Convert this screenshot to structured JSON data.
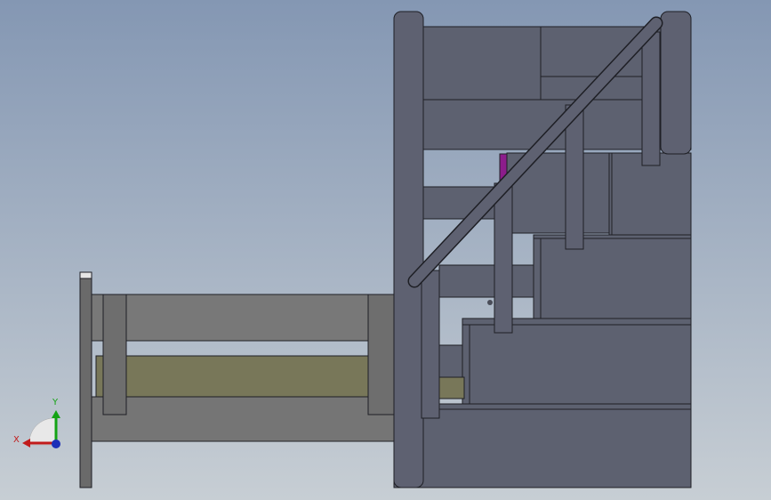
{
  "viewport": {
    "background_top": "#8497b3",
    "background_bottom": "#c7ced4"
  },
  "colors": {
    "stair_body": "#5d6170",
    "stair_edge": "#1e1f25",
    "rail": "#5e6171",
    "frame_grey": "#777777",
    "frame_dark": "#6b6b6b",
    "olive_panel": "#787759",
    "magenta_part": "#8c1d8c",
    "x_axis": "#c11b1b",
    "y_axis": "#14a314",
    "z_axis": "#1d2fb8"
  },
  "triad": {
    "x_label": "X",
    "y_label": "Y",
    "x_icon": "x-axis-arrow-icon",
    "y_icon": "y-axis-arrow-icon",
    "z_icon": "z-axis-origin-icon"
  }
}
